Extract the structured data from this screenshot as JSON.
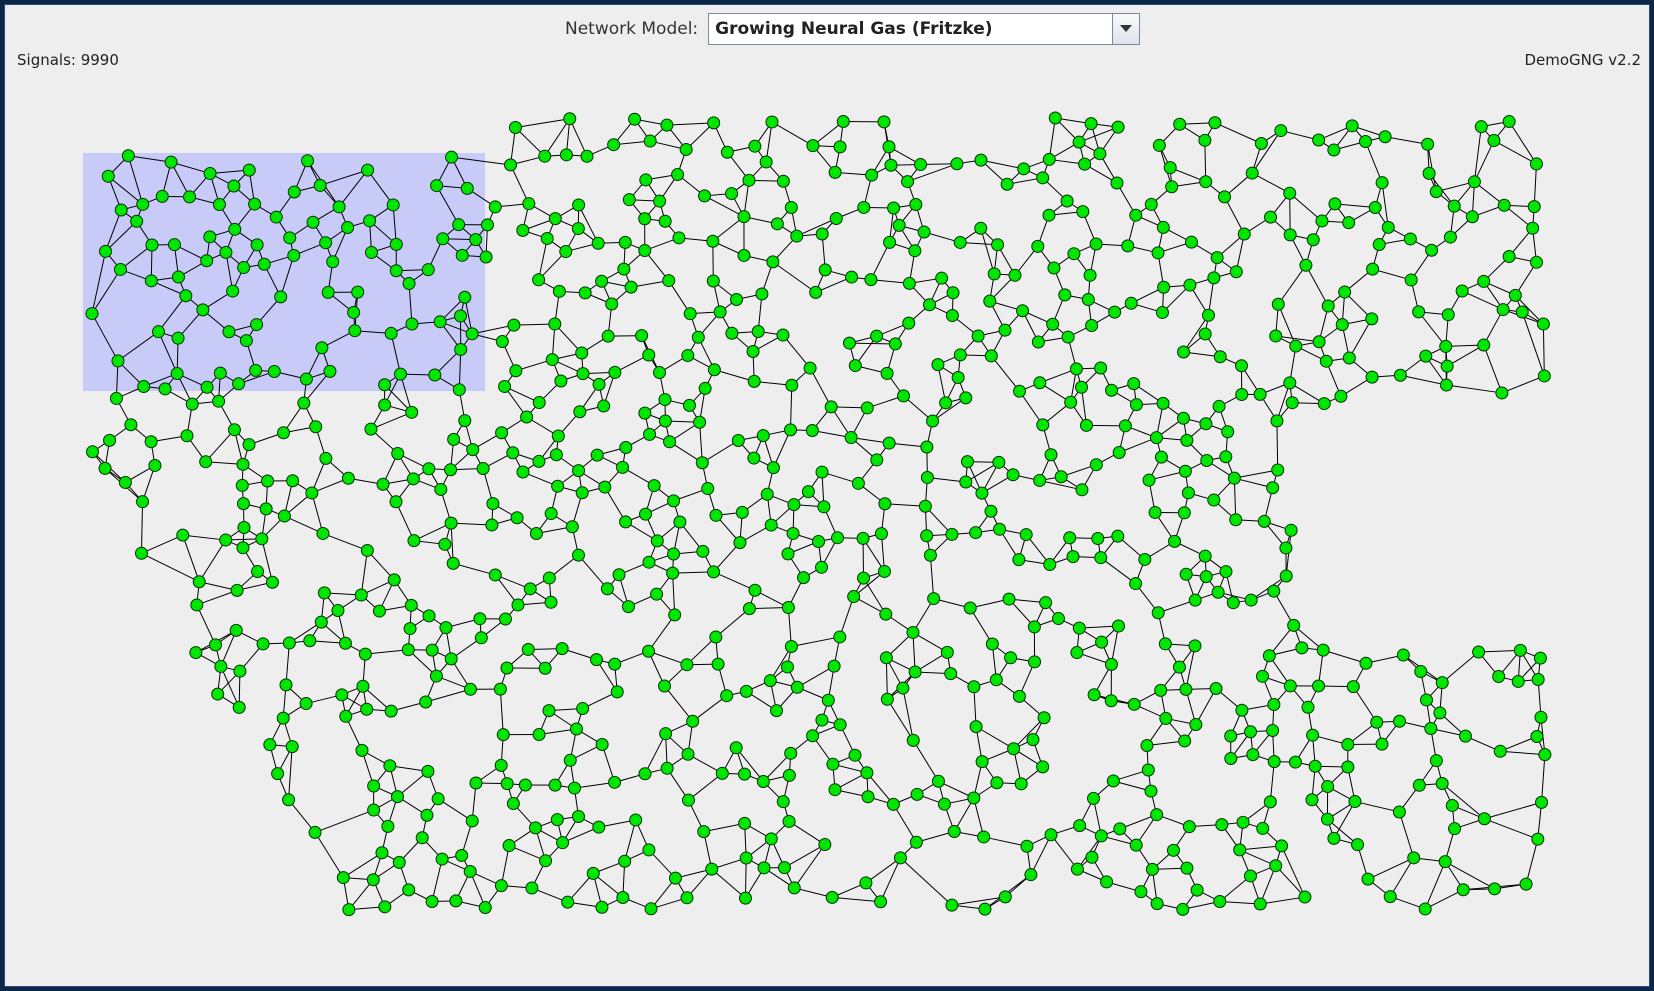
{
  "header": {
    "model_label": "Network Model:",
    "model_value": "Growing Neural Gas (Fritzke)",
    "model_arrow_icon": "chevron-down-icon"
  },
  "status": {
    "signals": "Signals: 9990",
    "version": "DemoGNG v2.2"
  },
  "colors": {
    "window_frame": "#0b2748",
    "panel_background": "#eeeeee",
    "selection_region": "#c8caf8",
    "node_fill": "#00e600",
    "node_stroke": "#003300",
    "edge": "#000000"
  }
}
